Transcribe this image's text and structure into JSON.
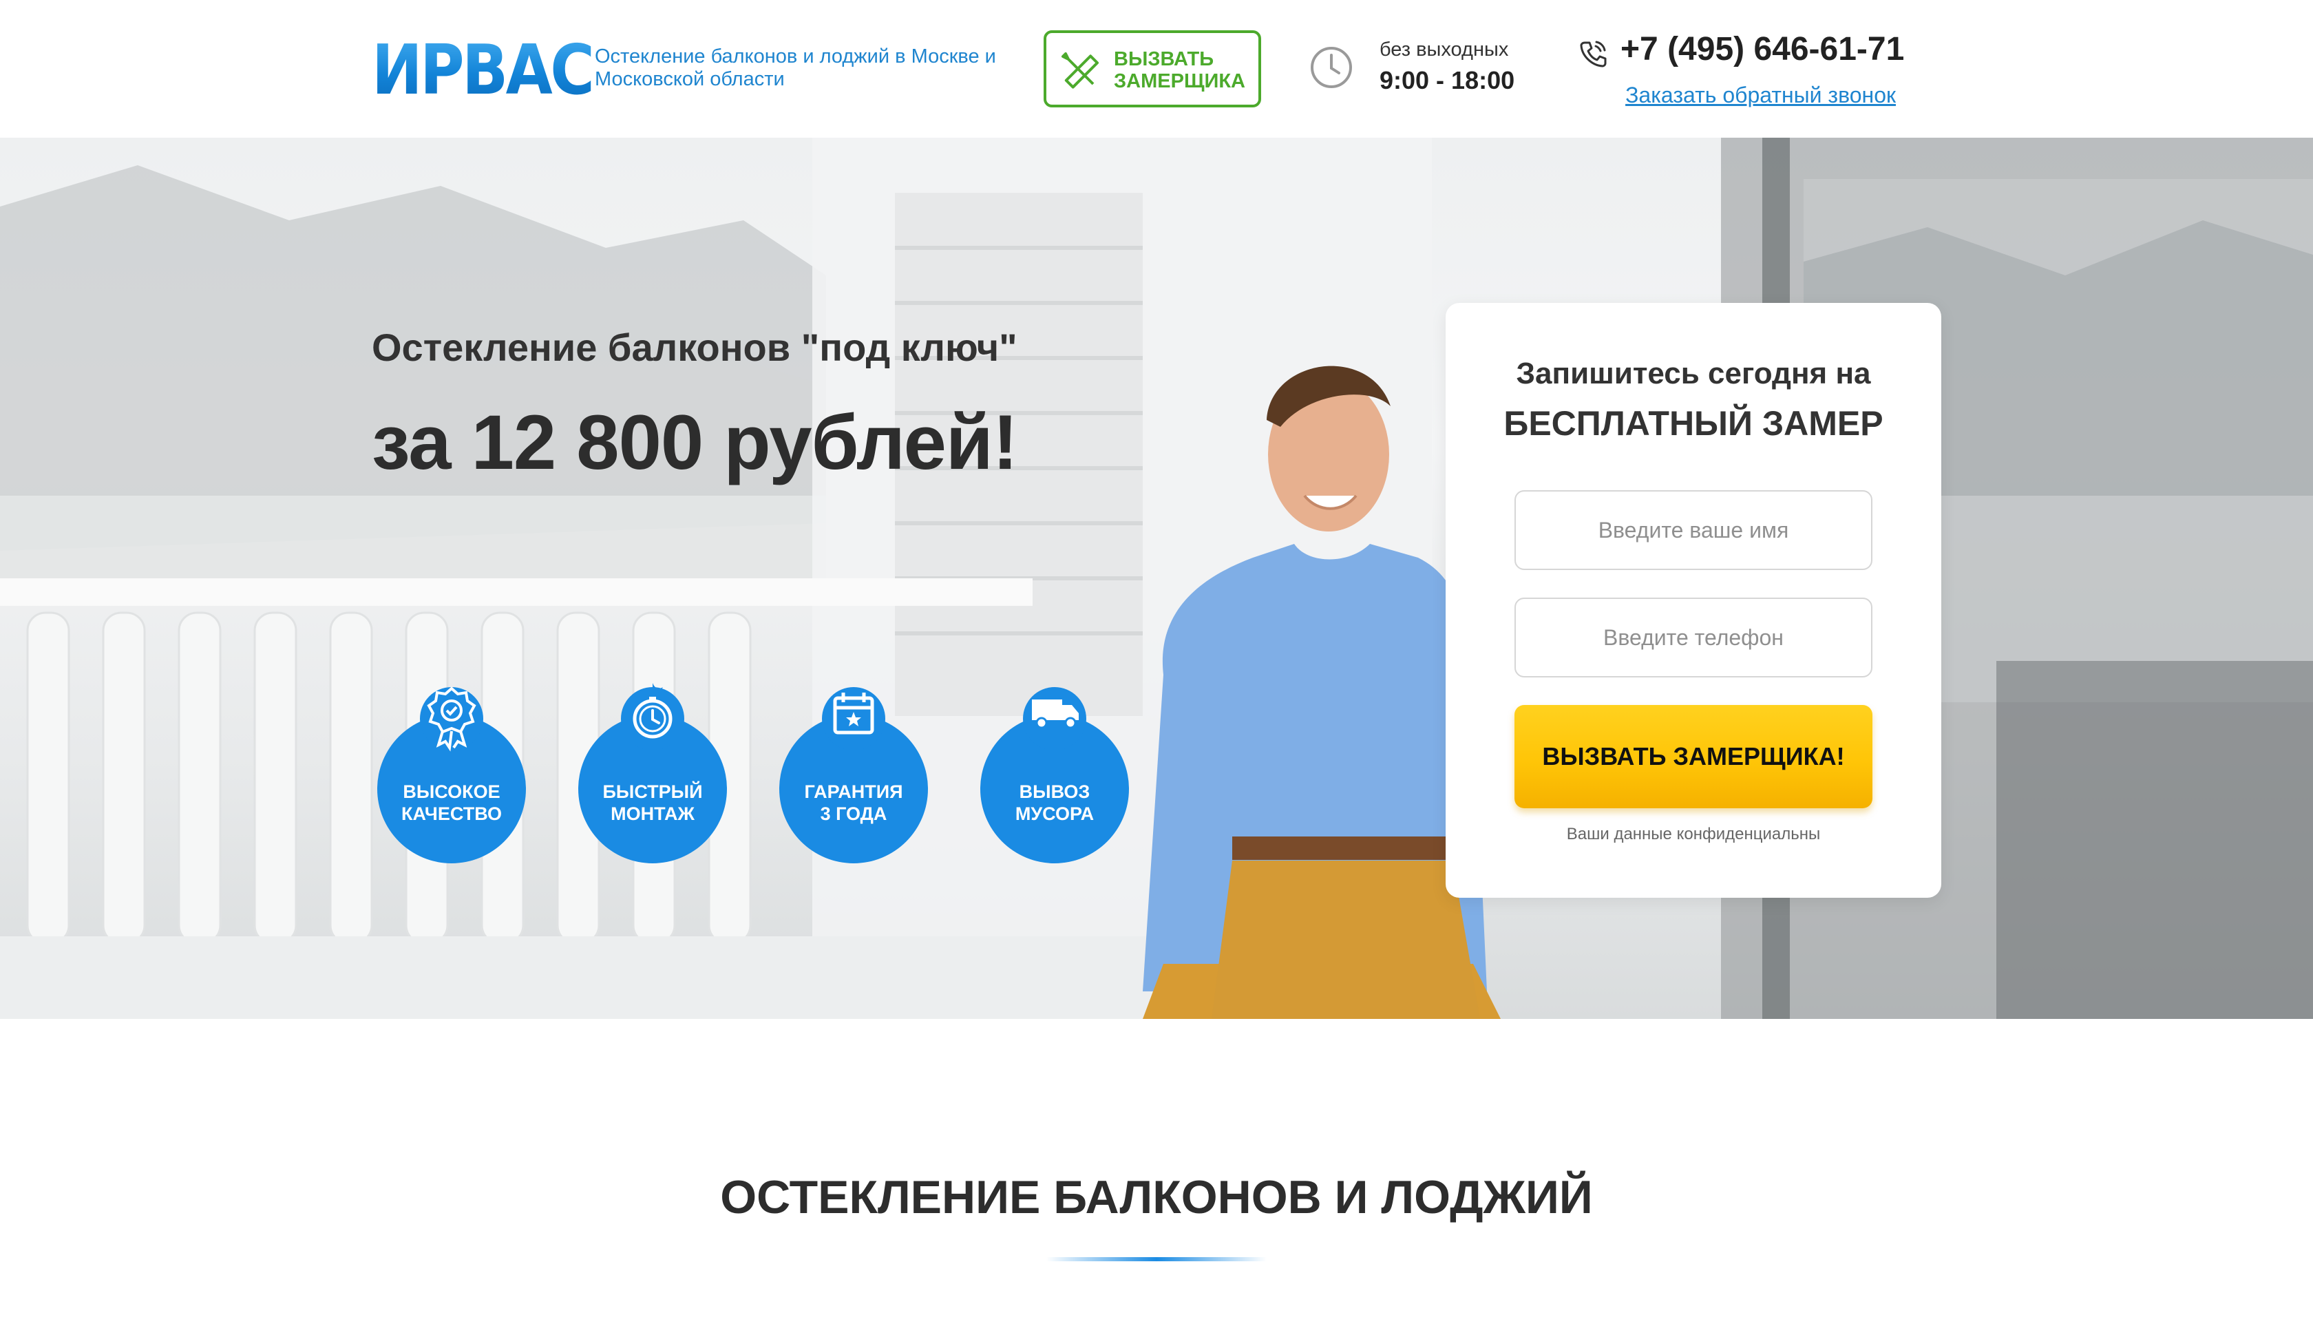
{
  "header": {
    "logo": "ИРВАС",
    "tagline": "Остекление балконов и лоджий в Москве и Московской области",
    "measure_button": "ВЫЗВАТЬ\nЗАМЕРЩИКА",
    "hours_note": "без выходных",
    "hours": "9:00 - 18:00",
    "phone": "+7 (495) 646-61-71",
    "callback_link": "Заказать обратный звонок"
  },
  "hero": {
    "subtitle": "Остекление балконов \"под ключ\"",
    "price": "за 12 800 рублей!",
    "features": [
      {
        "label": "ВЫСОКОЕ\nКАЧЕСТВО",
        "icon": "award-badge-icon"
      },
      {
        "label": "БЫСТРЫЙ\nМОНТАЖ",
        "icon": "stopwatch-icon"
      },
      {
        "label": "ГАРАНТИЯ\n3 ГОДА",
        "icon": "calendar-icon"
      },
      {
        "label": "ВЫВОЗ\nМУСОРА",
        "icon": "truck-icon"
      }
    ]
  },
  "form": {
    "title_line1": "Запишитесь сегодня на",
    "title_line2": "БЕСПЛАТНЫЙ ЗАМЕР",
    "name_placeholder": "Введите ваше имя",
    "phone_placeholder": "Введите телефон",
    "submit_label": "ВЫЗВАТЬ ЗАМЕРЩИКА!",
    "privacy_note": "Ваши данные конфиденциальны"
  },
  "section": {
    "title": "ОСТЕКЛЕНИЕ БАЛКОНОВ И ЛОДЖИЙ"
  },
  "colors": {
    "brand_blue": "#1a8be3",
    "accent_green": "#4caa2c",
    "accent_yellow": "#ffc507"
  }
}
